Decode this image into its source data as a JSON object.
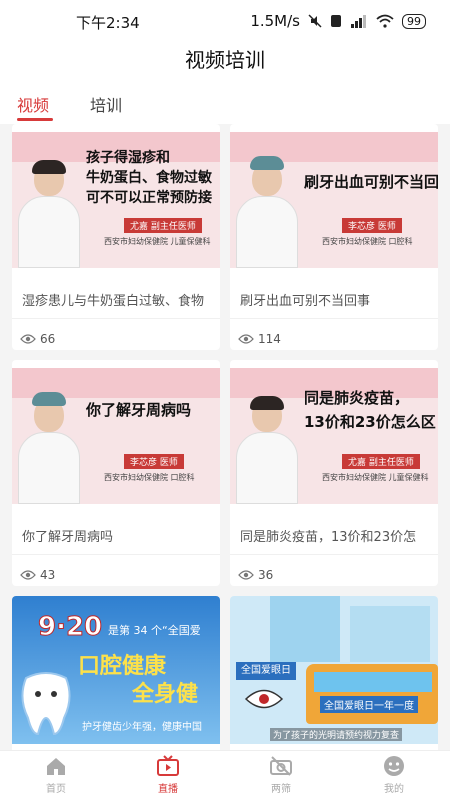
{
  "status": {
    "time": "下午2:34",
    "speed": "1.5M/s",
    "battery": "99"
  },
  "header": {
    "title": "视频培训"
  },
  "tabs": [
    {
      "label": "视频"
    },
    {
      "label": "培训"
    }
  ],
  "cards": [
    {
      "thumb_lines": [
        "孩子得湿疹和",
        "牛奶蛋白、食物过敏",
        "可不可以正常预防接"
      ],
      "doctor": "尤嘉  副主任医师",
      "hospital": "西安市妇幼保健院 儿童保健科",
      "title": "湿疹患儿与牛奶蛋白过敏、食物",
      "views": "66"
    },
    {
      "thumb_lines": [
        "刷牙出血可别不当回"
      ],
      "doctor": "李芯彦  医师",
      "hospital": "西安市妇幼保健院 口腔科",
      "title": "刷牙出血可别不当回事",
      "views": "114"
    },
    {
      "thumb_lines": [
        "你了解牙周病吗"
      ],
      "doctor": "李芯彦  医师",
      "hospital": "西安市妇幼保健院 口腔科",
      "title": "你了解牙周病吗",
      "views": "43"
    },
    {
      "thumb_lines": [
        "同是肺炎疫苗，",
        "13价和23价怎么区"
      ],
      "doctor": "尤嘉  副主任医师",
      "hospital": "西安市妇幼保健院 儿童保健科",
      "title": "同是肺炎疫苗，13价和23价怎",
      "views": "36"
    }
  ],
  "posters": [
    {
      "date": "9·20",
      "line1": "是第 34 个“全国爱",
      "line2": "口腔健康",
      "line3": "全身健",
      "slogan": "护牙健齿少年强，健康中国"
    },
    {
      "sign1": "全国爱眼日",
      "sign2": "全国爱眼日一年一度",
      "caption": "为了孩子的光明请预约视力复查"
    }
  ],
  "nav": [
    {
      "label": "首页"
    },
    {
      "label": "直播"
    },
    {
      "label": "两筛"
    },
    {
      "label": "我的"
    }
  ],
  "colors": {
    "accent": "#d73a3a"
  }
}
